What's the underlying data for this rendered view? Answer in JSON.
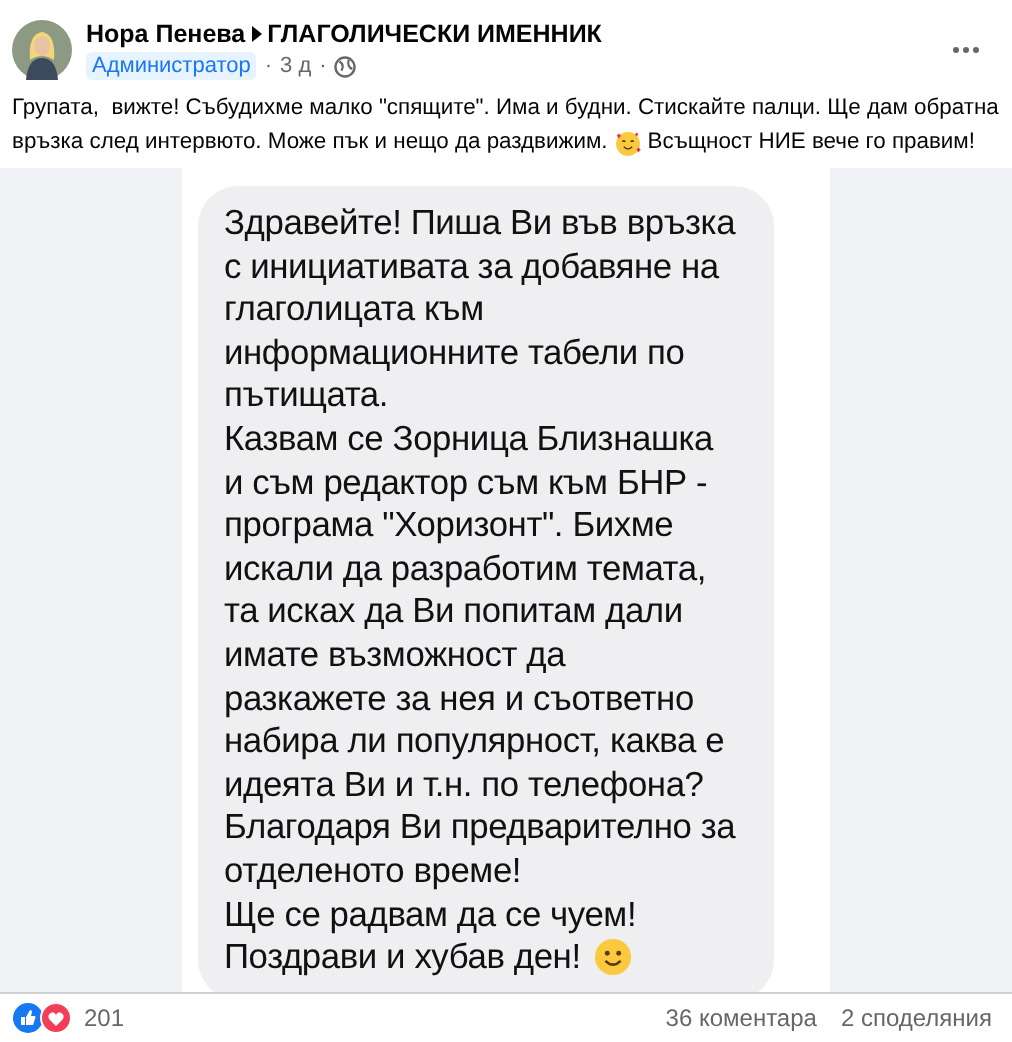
{
  "post": {
    "author": "Нора Пенева",
    "group": "ГЛАГОЛИЧЕСКИ ИМЕННИК",
    "badge": "Администратор",
    "time": "3 д",
    "separator": "·",
    "text_lines": [
      "Групата,  вижте! Събудихме малко \"спящите\". Има и будни. Стискайте палци. Ще дам обратна",
      "връзка след интервюто. Може пък и нещо да раздвижим."
    ],
    "text_after_emoji": "Всъщност НИЕ вече го правим!"
  },
  "message_lines": [
    "Здравейте! Пиша Ви във връзка",
    "с инициативата за добавяне на",
    "глаголицата към",
    "информационните табели по",
    "пътищата.",
    "Казвам се Зорница Близнашка",
    "и съм редактор съм към БНР -",
    "програма \"Хоризонт\". Бихме",
    "искали да разработим темата,",
    "та исках да Ви попитам дали",
    "имате възможност да",
    "разкажете за нея и съответно",
    "набира ли популярност, каква е",
    "идеята Ви и т.н. по телефона?",
    "Благодаря Ви предварително за",
    "отделеното време!",
    "Ще се радвам да се чуем!",
    "Поздрави и хубав ден!"
  ],
  "footer": {
    "reactions": "201",
    "comments": "36 коментара",
    "shares": "2 споделяния"
  }
}
